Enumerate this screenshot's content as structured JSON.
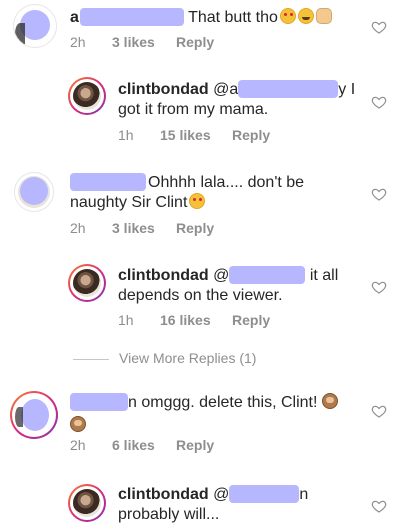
{
  "colors": {
    "text": "#262626",
    "meta": "#8e8e8e",
    "redaction": "#b7b7ff",
    "heart_stroke": "#8e8e8e"
  },
  "view_more": {
    "label": "View More Replies (1)"
  },
  "comments": [
    {
      "username": "a",
      "text": "That butt tho",
      "emojis": [
        "heart-eyes-emoji",
        "grinning-emoji",
        "ok-hand-emoji"
      ],
      "time": "2h",
      "likes": "3 likes",
      "reply": "Reply"
    },
    {
      "username": "clintbondad",
      "mention_prefix": "@a",
      "mention_suffix": "y",
      "text": "I got it from my mama.",
      "time": "1h",
      "likes": "15 likes",
      "reply": "Reply"
    },
    {
      "username": "",
      "text": "Ohhhh lala.... don't be naughty Sir Clint",
      "emojis": [
        "heart-eyes-emoji"
      ],
      "time": "2h",
      "likes": "3 likes",
      "reply": "Reply"
    },
    {
      "username": "clintbondad",
      "mention_prefix": "@",
      "text": "it all depends on the viewer.",
      "time": "1h",
      "likes": "16 likes",
      "reply": "Reply"
    },
    {
      "username": "",
      "text": "n omggg. delete this, Clint!",
      "emojis": [
        "see-no-evil-monkey-emoji",
        "see-no-evil-monkey-emoji"
      ],
      "time": "2h",
      "likes": "6 likes",
      "reply": "Reply"
    },
    {
      "username": "clintbondad",
      "mention_prefix": "@",
      "text": "n probably will...",
      "time": "",
      "likes": "",
      "reply": ""
    }
  ],
  "icons": {
    "heart": "heart-outline-icon"
  }
}
